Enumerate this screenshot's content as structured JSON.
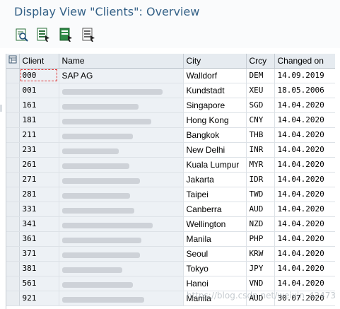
{
  "window": {
    "title": "Display View \"Clients\": Overview"
  },
  "toolbar": {
    "buttons": [
      {
        "icon": "find-icon"
      },
      {
        "icon": "select-all-icon"
      },
      {
        "icon": "select-block-icon"
      },
      {
        "icon": "deselect-all-icon"
      }
    ]
  },
  "table": {
    "columns": [
      "Client",
      "Name",
      "City",
      "Crcy",
      "Changed on"
    ],
    "rows": [
      {
        "client": "000",
        "name": "SAP AG",
        "city": "Walldorf",
        "crcy": "DEM",
        "changed": "14.09.2019"
      },
      {
        "client": "001",
        "name": "",
        "city": "Kundstadt",
        "crcy": "XEU",
        "changed": "18.05.2006"
      },
      {
        "client": "161",
        "name": "",
        "city": "Singapore",
        "crcy": "SGD",
        "changed": "14.04.2020"
      },
      {
        "client": "181",
        "name": "",
        "city": "Hong Kong",
        "crcy": "CNY",
        "changed": "14.04.2020"
      },
      {
        "client": "211",
        "name": "",
        "city": "Bangkok",
        "crcy": "THB",
        "changed": "14.04.2020"
      },
      {
        "client": "231",
        "name": "",
        "city": "New Delhi",
        "crcy": "INR",
        "changed": "14.04.2020"
      },
      {
        "client": "261",
        "name": "",
        "city": "Kuala Lumpur",
        "crcy": "MYR",
        "changed": "14.04.2020"
      },
      {
        "client": "271",
        "name": "",
        "city": "Jakarta",
        "crcy": "IDR",
        "changed": "14.04.2020"
      },
      {
        "client": "281",
        "name": "",
        "city": "Taipei",
        "crcy": "TWD",
        "changed": "14.04.2020"
      },
      {
        "client": "331",
        "name": "",
        "city": "Canberra",
        "crcy": "AUD",
        "changed": "14.04.2020"
      },
      {
        "client": "341",
        "name": "",
        "city": "Wellington",
        "crcy": "NZD",
        "changed": "14.04.2020"
      },
      {
        "client": "361",
        "name": "",
        "city": "Manila",
        "crcy": "PHP",
        "changed": "14.04.2020"
      },
      {
        "client": "371",
        "name": "",
        "city": "Seoul",
        "crcy": "KRW",
        "changed": "14.04.2020"
      },
      {
        "client": "381",
        "name": "",
        "city": "Tokyo",
        "crcy": "JPY",
        "changed": "14.04.2020"
      },
      {
        "client": "561",
        "name": "",
        "city": "Hanoi",
        "crcy": "VND",
        "changed": "14.04.2020"
      },
      {
        "client": "921",
        "name": "",
        "city": "Manila",
        "crcy": "AUD",
        "changed": "30.07.2020"
      }
    ]
  },
  "watermark": "https://blog.csdn.net/weixin_42473"
}
